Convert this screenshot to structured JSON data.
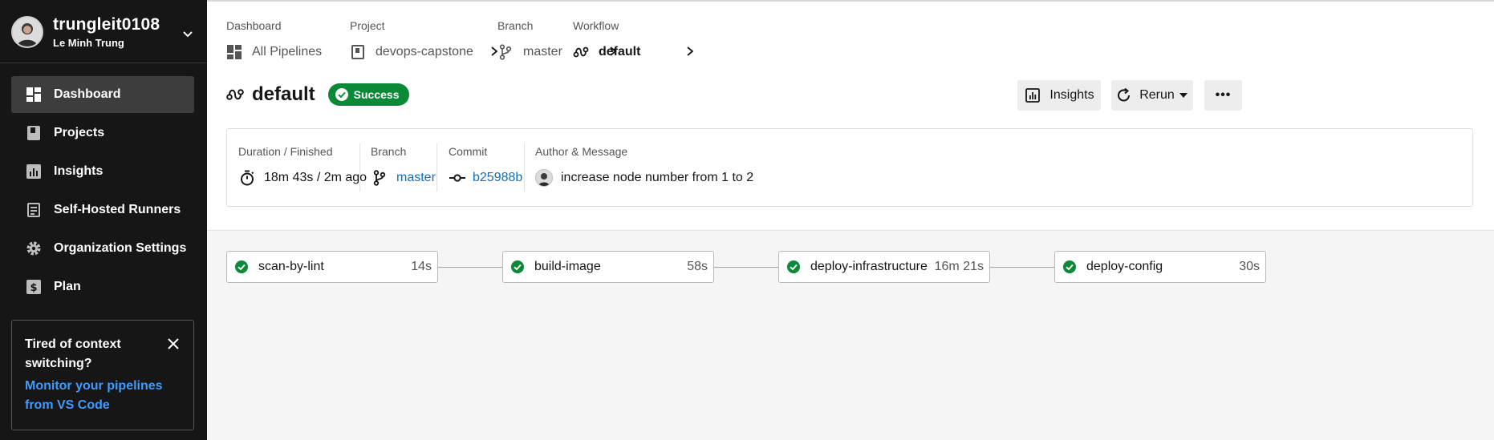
{
  "user": {
    "username": "trungleit0108",
    "full_name": "Le Minh Trung"
  },
  "sidebar": {
    "items": [
      {
        "label": "Dashboard",
        "icon": "dashboard-icon",
        "active": true
      },
      {
        "label": "Projects",
        "icon": "book-icon",
        "active": false
      },
      {
        "label": "Insights",
        "icon": "chart-icon",
        "active": false
      },
      {
        "label": "Self-Hosted Runners",
        "icon": "runner-icon",
        "active": false
      },
      {
        "label": "Organization Settings",
        "icon": "gear-icon",
        "active": false
      },
      {
        "label": "Plan",
        "icon": "dollar-icon",
        "active": false
      }
    ],
    "promo": {
      "title": "Tired of context switching?",
      "link": "Monitor your pipelines from VS Code"
    }
  },
  "breadcrumb": {
    "dashboard": {
      "label": "Dashboard",
      "value": "All Pipelines"
    },
    "project": {
      "label": "Project",
      "value": "devops-capstone"
    },
    "branch": {
      "label": "Branch",
      "value": "master"
    },
    "workflow": {
      "label": "Workflow",
      "value": "default"
    }
  },
  "workflow": {
    "title": "default",
    "status": "Success",
    "status_color": "#0a8a37"
  },
  "actions": {
    "insights": "Insights",
    "rerun": "Rerun",
    "more": "•••"
  },
  "info": {
    "duration": {
      "label": "Duration / Finished",
      "value": "18m 43s / 2m ago"
    },
    "branch": {
      "label": "Branch",
      "value": "master"
    },
    "commit": {
      "label": "Commit",
      "value": "b25988b"
    },
    "author": {
      "label": "Author & Message",
      "value": "increase node number from 1 to 2"
    }
  },
  "jobs": [
    {
      "name": "scan-by-lint",
      "duration": "14s",
      "status": "success"
    },
    {
      "name": "build-image",
      "duration": "58s",
      "status": "success"
    },
    {
      "name": "deploy-infrastructure",
      "duration": "16m 21s",
      "status": "success"
    },
    {
      "name": "deploy-config",
      "duration": "30s",
      "status": "success"
    }
  ],
  "colors": {
    "sidebar_bg": "#161616",
    "active_item": "#3d3d3d",
    "link": "#0d6fc8",
    "promo_link": "#3e9bff",
    "success": "#0a8a37"
  }
}
